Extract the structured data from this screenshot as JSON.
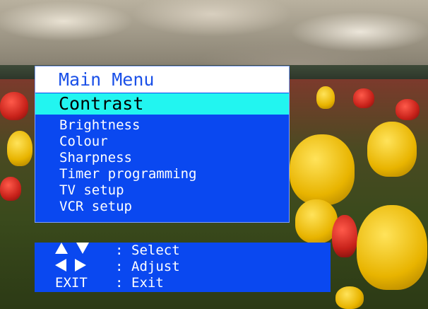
{
  "menu": {
    "title": "Main Menu",
    "selected": "Contrast",
    "items": [
      "Brightness",
      "Colour",
      "Sharpness",
      "Timer programming",
      "TV setup",
      "VCR setup"
    ]
  },
  "help": [
    {
      "keys": "up-down-arrows",
      "colon": ":",
      "action": "Select"
    },
    {
      "keys": "left-right-arrows",
      "colon": ":",
      "action": "Adjust"
    },
    {
      "keys": "EXIT",
      "colon": ":",
      "action": "Exit"
    }
  ],
  "colors": {
    "panel": "#0a48f0",
    "title_bg": "#ffffff",
    "title_text": "#1a50e8",
    "highlight": "#22f5f0",
    "text": "#ffffff"
  }
}
